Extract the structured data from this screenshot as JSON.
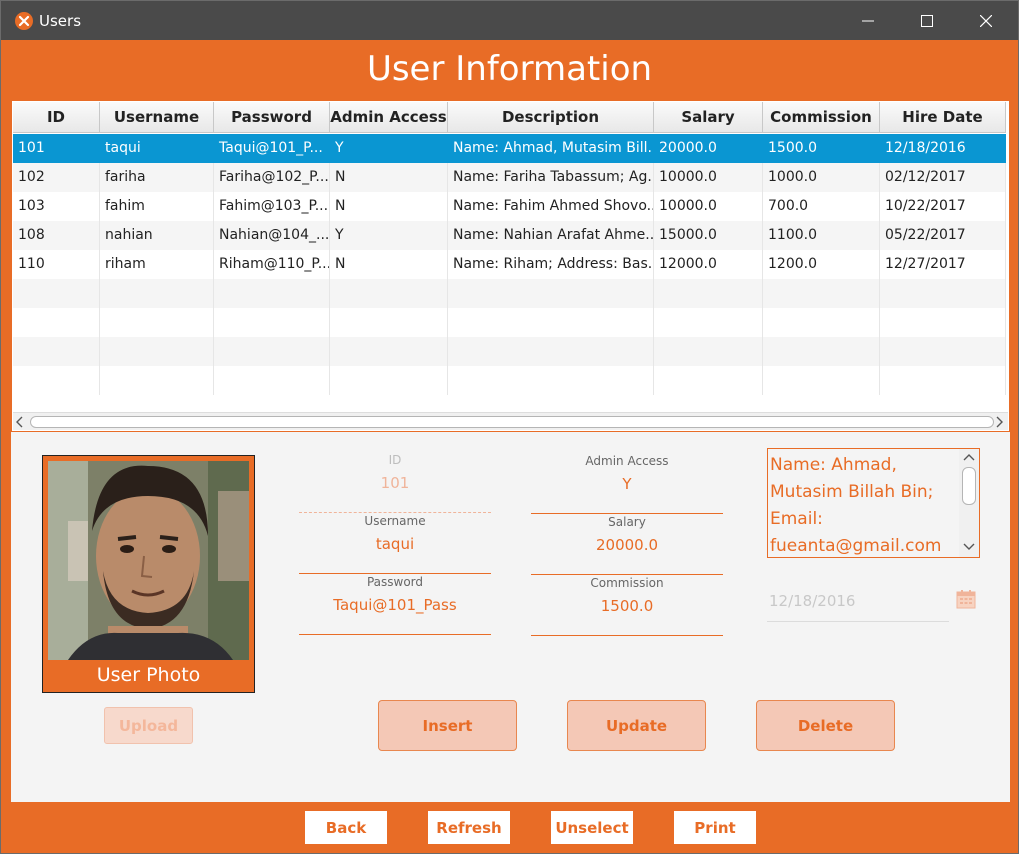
{
  "window": {
    "title": "Users"
  },
  "header": {
    "title": "User Information"
  },
  "table": {
    "columns": [
      "ID",
      "Username",
      "Password",
      "Admin Access",
      "Description",
      "Salary",
      "Commission",
      "Hire Date"
    ],
    "rows": [
      [
        "101",
        "taqui",
        "Taqui@101_P...",
        "Y",
        "Name: Ahmad, Mutasim Bill...",
        "20000.0",
        "1500.0",
        "12/18/2016"
      ],
      [
        "102",
        "fariha",
        "Fariha@102_P...",
        "N",
        "Name: Fariha Tabassum; Ag...",
        "10000.0",
        "1000.0",
        "02/12/2017"
      ],
      [
        "103",
        "fahim",
        "Fahim@103_P...",
        "N",
        "Name: Fahim Ahmed Shovo...",
        "10000.0",
        "700.0",
        "10/22/2017"
      ],
      [
        "108",
        "nahian",
        "Nahian@104_...",
        "Y",
        "Name: Nahian Arafat Ahme...",
        "15000.0",
        "1100.0",
        "05/22/2017"
      ],
      [
        "110",
        "riham",
        "Riham@110_P...",
        "N",
        "Name: Riham; Address: Bas...",
        "12000.0",
        "1200.0",
        "12/27/2017"
      ]
    ],
    "selected_row": 0
  },
  "photo": {
    "caption": "User Photo"
  },
  "form": {
    "id": {
      "label": "ID",
      "value": "101"
    },
    "username": {
      "label": "Username",
      "value": "taqui"
    },
    "password": {
      "label": "Password",
      "value": "Taqui@101_Pass"
    },
    "admin_access": {
      "label": "Admin Access",
      "value": "Y"
    },
    "salary": {
      "label": "Salary",
      "value": "20000.0"
    },
    "commission": {
      "label": "Commission",
      "value": "1500.0"
    },
    "description_lines": [
      "Name: Ahmad,",
      "Mutasim Billah Bin;",
      "Email:",
      "fueanta@gmail.com"
    ],
    "hire_date": "12/18/2016"
  },
  "buttons": {
    "upload": "Upload",
    "insert": "Insert",
    "update": "Update",
    "delete": "Delete"
  },
  "footer": {
    "back": "Back",
    "refresh": "Refresh",
    "unselect": "Unselect",
    "print": "Print"
  },
  "colors": {
    "accent": "#e86c26",
    "selection": "#0a96d2",
    "titlebar": "#4a4a4a"
  },
  "icons": [
    "app-logo-icon",
    "minimize-icon",
    "maximize-icon",
    "close-icon",
    "chevron-left-icon",
    "chevron-right-icon",
    "chevron-up-icon",
    "chevron-down-icon",
    "calendar-icon"
  ]
}
